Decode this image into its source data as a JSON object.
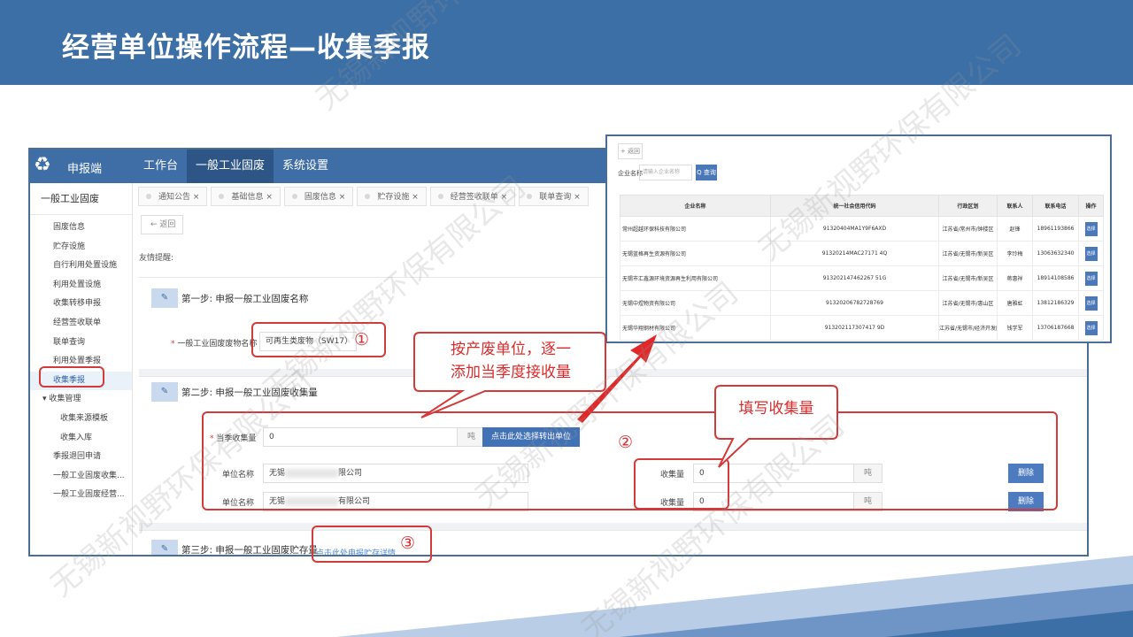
{
  "slide": {
    "title": "经营单位操作流程—收集季报",
    "watermark": "无锡新视野环保有限公司"
  },
  "app": {
    "name": "申报端",
    "nav": [
      "工作台",
      "一般工业固废",
      "系统设置"
    ],
    "nav_active": "一般工业固废",
    "sidebar": {
      "title": "一般工业固废",
      "items": [
        "固废信息",
        "贮存设施",
        "自行利用处置设施",
        "利用处置设施",
        "收集转移申报",
        "经营签收联单",
        "联单查询",
        "利用处置季报",
        "收集季报",
        "收集管理",
        "收集来源模板",
        "收集入库",
        "季报退回申请",
        "一般工业固废收集...",
        "一般工业固废经营..."
      ],
      "active": "收集季报"
    },
    "tabs": [
      "通知公告",
      "基础信息",
      "固废信息",
      "贮存设施",
      "经营签收联单",
      "联单查询"
    ],
    "tab_close": "×",
    "back": "← 返回",
    "hint": "友情提醒:",
    "step1": {
      "title": "第一步: 申报一般工业固废名称",
      "label": "一般工业固废废物名称",
      "value": "可再生类废物（SW17）"
    },
    "step2": {
      "title": "第二步: 申报一般工业固废收集量",
      "qty_label": "当季收集量",
      "qty_value": "0",
      "unit": "吨",
      "select_button": "点击此处选择转出单位",
      "unit_name_label": "单位名称",
      "rows": [
        {
          "name_prefix": "无锡",
          "name_suffix": "限公司",
          "amount_label": "收集量",
          "amount": "0",
          "unit": "吨",
          "delete": "删除"
        },
        {
          "name_prefix": "无锡",
          "name_suffix": "有限公司",
          "amount_label": "收集量",
          "amount": "0",
          "unit": "吨",
          "delete": "删除"
        }
      ]
    },
    "step3": {
      "title": "第三步: 申报一般工业固废贮存量",
      "link": "点击此处申报贮存详情"
    }
  },
  "popup": {
    "add": "+ 返回",
    "search_label": "企业名称",
    "search_placeholder": "请输入企业名称",
    "search_button": "Q 查询",
    "headers": [
      "企业名称",
      "统一社会信用代码",
      "行政区划",
      "联系人",
      "联系电话",
      "操作"
    ],
    "rows": [
      [
        "常州超越环保科技有限公司",
        "91320404MA1Y9F6AXD",
        "江苏省/常州市/钟楼区",
        "赵锋",
        "18961193866",
        "选择"
      ],
      [
        "无锡蓝格再生资源有限公司",
        "91320214MAC27171 4Q",
        "江苏省/无锡市/新吴区",
        "李玲梅",
        "13063632340",
        "选择"
      ],
      [
        "无锡市汇鑫源环境资源再生利用有限公司",
        "913202147462267 51G",
        "江苏省/无锡市/新吴区",
        "蒋惠祥",
        "18914108586",
        "选择"
      ],
      [
        "无锡中煜物资有限公司",
        "91320206782728769",
        "江苏省/无锡市/惠山区",
        "唐雅虹",
        "13812186329",
        "选择"
      ],
      [
        "无锡华翔钢材有限公司",
        "913202117307417 9D",
        "江苏省/无锡市/经济开发区",
        "钱学军",
        "13706187668",
        "选择"
      ]
    ]
  },
  "annotations": {
    "num1": "①",
    "num2": "②",
    "num3": "③",
    "callout1_line1": "按产废单位，逐一",
    "callout1_line2": "添加当季度接收量",
    "callout2": "填写收集量"
  },
  "colors": {
    "header": "#3c6fa6",
    "annotation": "#d92d2d",
    "primary": "#4272b6"
  }
}
